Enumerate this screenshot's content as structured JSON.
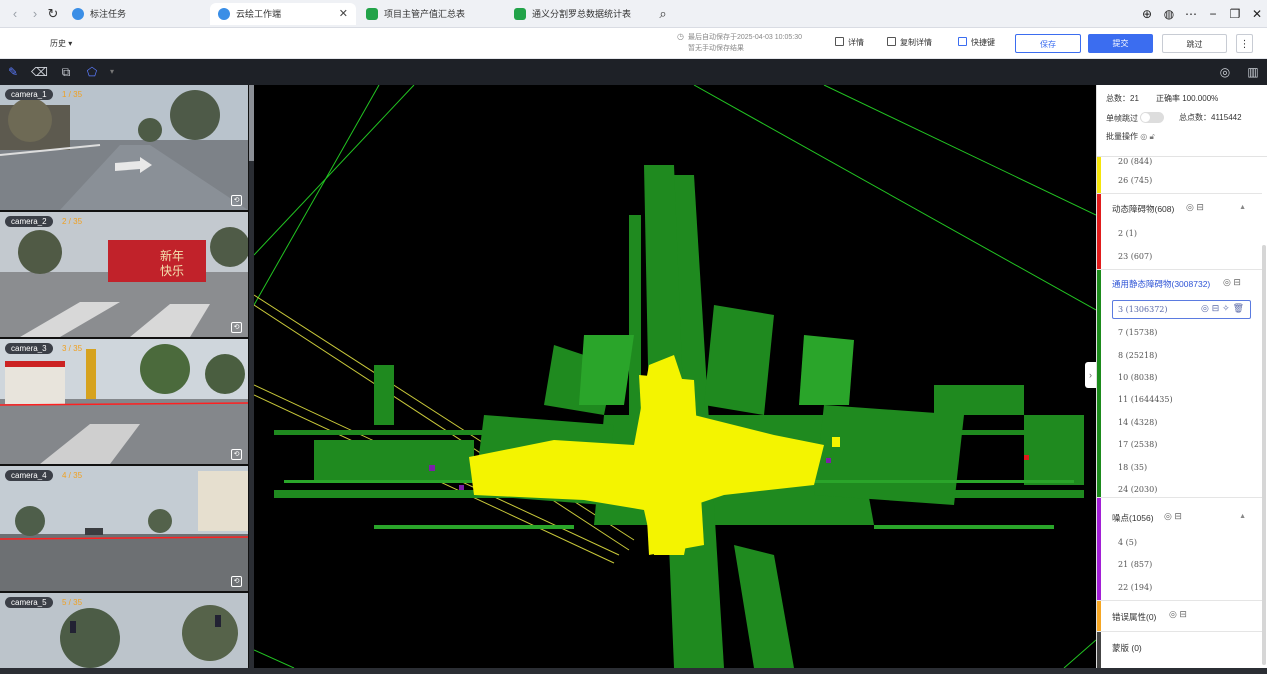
{
  "browser": {
    "tabs": [
      {
        "label": "标注任务",
        "active": false,
        "icon_color": "#3a8ee6"
      },
      {
        "label": "云绘工作端",
        "active": true,
        "icon_color": "#3a8ee6"
      },
      {
        "label": "项目主管产值汇总表",
        "active": false,
        "icon_color": "#22a349"
      },
      {
        "label": "通义分割罗总数据统计表",
        "active": false,
        "icon_color": "#22a349"
      }
    ]
  },
  "header": {
    "history_label": "历史 ▾",
    "autosave_line1": "最后自动保存于2025-04-03 10:05:30",
    "autosave_line2": "暂无手动保存结果",
    "details_label": "详情",
    "copy_details_label": "复制详情",
    "shortcuts_label": "快捷键",
    "save_label": "保存",
    "submit_label": "提交",
    "skip_label": "跳过",
    "more_label": "⋮"
  },
  "cameras": [
    {
      "name": "camera_1",
      "count": "1 / 35"
    },
    {
      "name": "camera_2",
      "count": "2 / 35"
    },
    {
      "name": "camera_3",
      "count": "3 / 35"
    },
    {
      "name": "camera_4",
      "count": "4 / 35"
    },
    {
      "name": "camera_5",
      "count": "5 / 35"
    }
  ],
  "panel": {
    "total_label": "总数：21",
    "accuracy_label": "正确率 100.000%",
    "single_skip_label": "单帧跳过",
    "total_points_label": "总点数：4115442",
    "batch_label": "批量操作",
    "top_items": [
      "20 (844)",
      "26 (745)"
    ],
    "groups": [
      {
        "title": "动态障碍物(608)",
        "color": "#e01b1b",
        "items": [
          "2 (1)",
          "23 (607)"
        ]
      },
      {
        "title": "通用静态障碍物(3008732)",
        "color": "#1b8a1b",
        "selected": "3 (1306372)",
        "items": [
          "7 (15738)",
          "8 (25218)",
          "10 (8038)",
          "11 (1644435)",
          "14 (4328)",
          "17 (2538)",
          "18 (35)",
          "24 (2030)"
        ]
      },
      {
        "title": "噪点(1056)",
        "color": "#a21fd6",
        "items": [
          "4 (5)",
          "21 (857)",
          "22 (194)"
        ]
      },
      {
        "title": "错误属性(0)",
        "color": "#f5a623",
        "items": []
      },
      {
        "title": "蒙版 (0)",
        "color": "#444444",
        "items": []
      }
    ]
  },
  "colors": {
    "accent": "#2e54d6",
    "primary_button": "#3b6df0"
  }
}
